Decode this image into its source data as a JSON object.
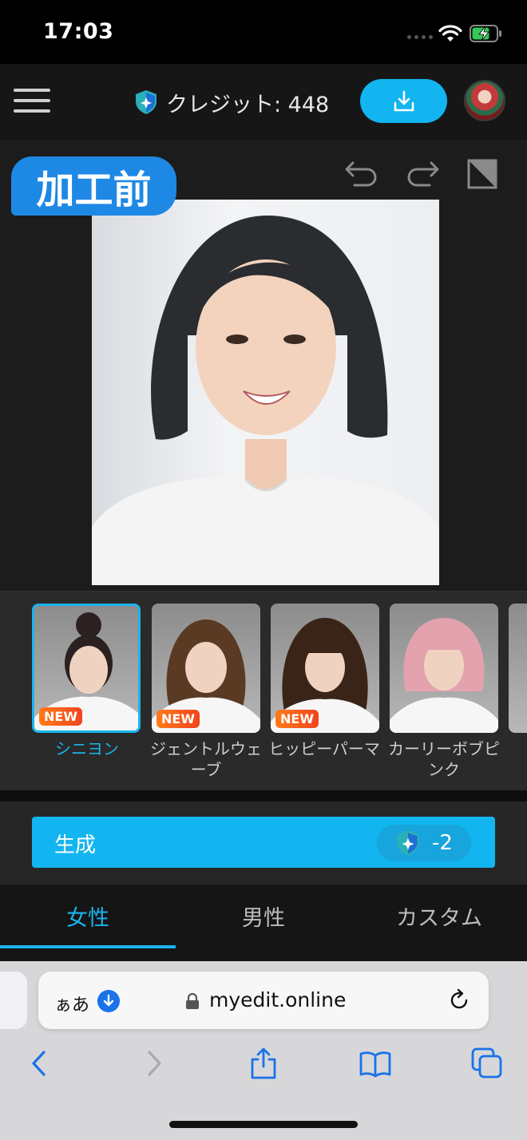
{
  "status_bar": {
    "time": "17:03"
  },
  "header": {
    "credit_label": "クレジット: 448",
    "icons": {
      "menu": "hamburger-icon",
      "credit": "shield-sparkle-icon",
      "download": "download-icon"
    }
  },
  "editor": {
    "before_label": "加工前",
    "tools": [
      "undo-icon",
      "redo-icon",
      "compare-icon"
    ]
  },
  "styles": {
    "badge_text": "NEW",
    "items": [
      {
        "label": "シニヨン",
        "is_new": true,
        "selected": true
      },
      {
        "label": "ジェントルウェーブ",
        "is_new": true,
        "selected": false
      },
      {
        "label": "ヒッピーパーマ",
        "is_new": true,
        "selected": false
      },
      {
        "label": "カーリーボブピンク",
        "is_new": false,
        "selected": false
      }
    ]
  },
  "generate": {
    "label": "生成",
    "cost": "-2"
  },
  "tabs": [
    {
      "label": "女性",
      "active": true
    },
    {
      "label": "男性",
      "active": false
    },
    {
      "label": "カスタム",
      "active": false
    }
  ],
  "browser": {
    "aa": "ぁあ",
    "url": "myedit.online",
    "nav_icons": [
      "back-icon",
      "forward-icon",
      "share-icon",
      "bookmarks-icon",
      "tabs-icon"
    ]
  },
  "colors": {
    "accent": "#12b5ef",
    "badge": "#1e88e5",
    "new_badge": "#f0451e"
  }
}
